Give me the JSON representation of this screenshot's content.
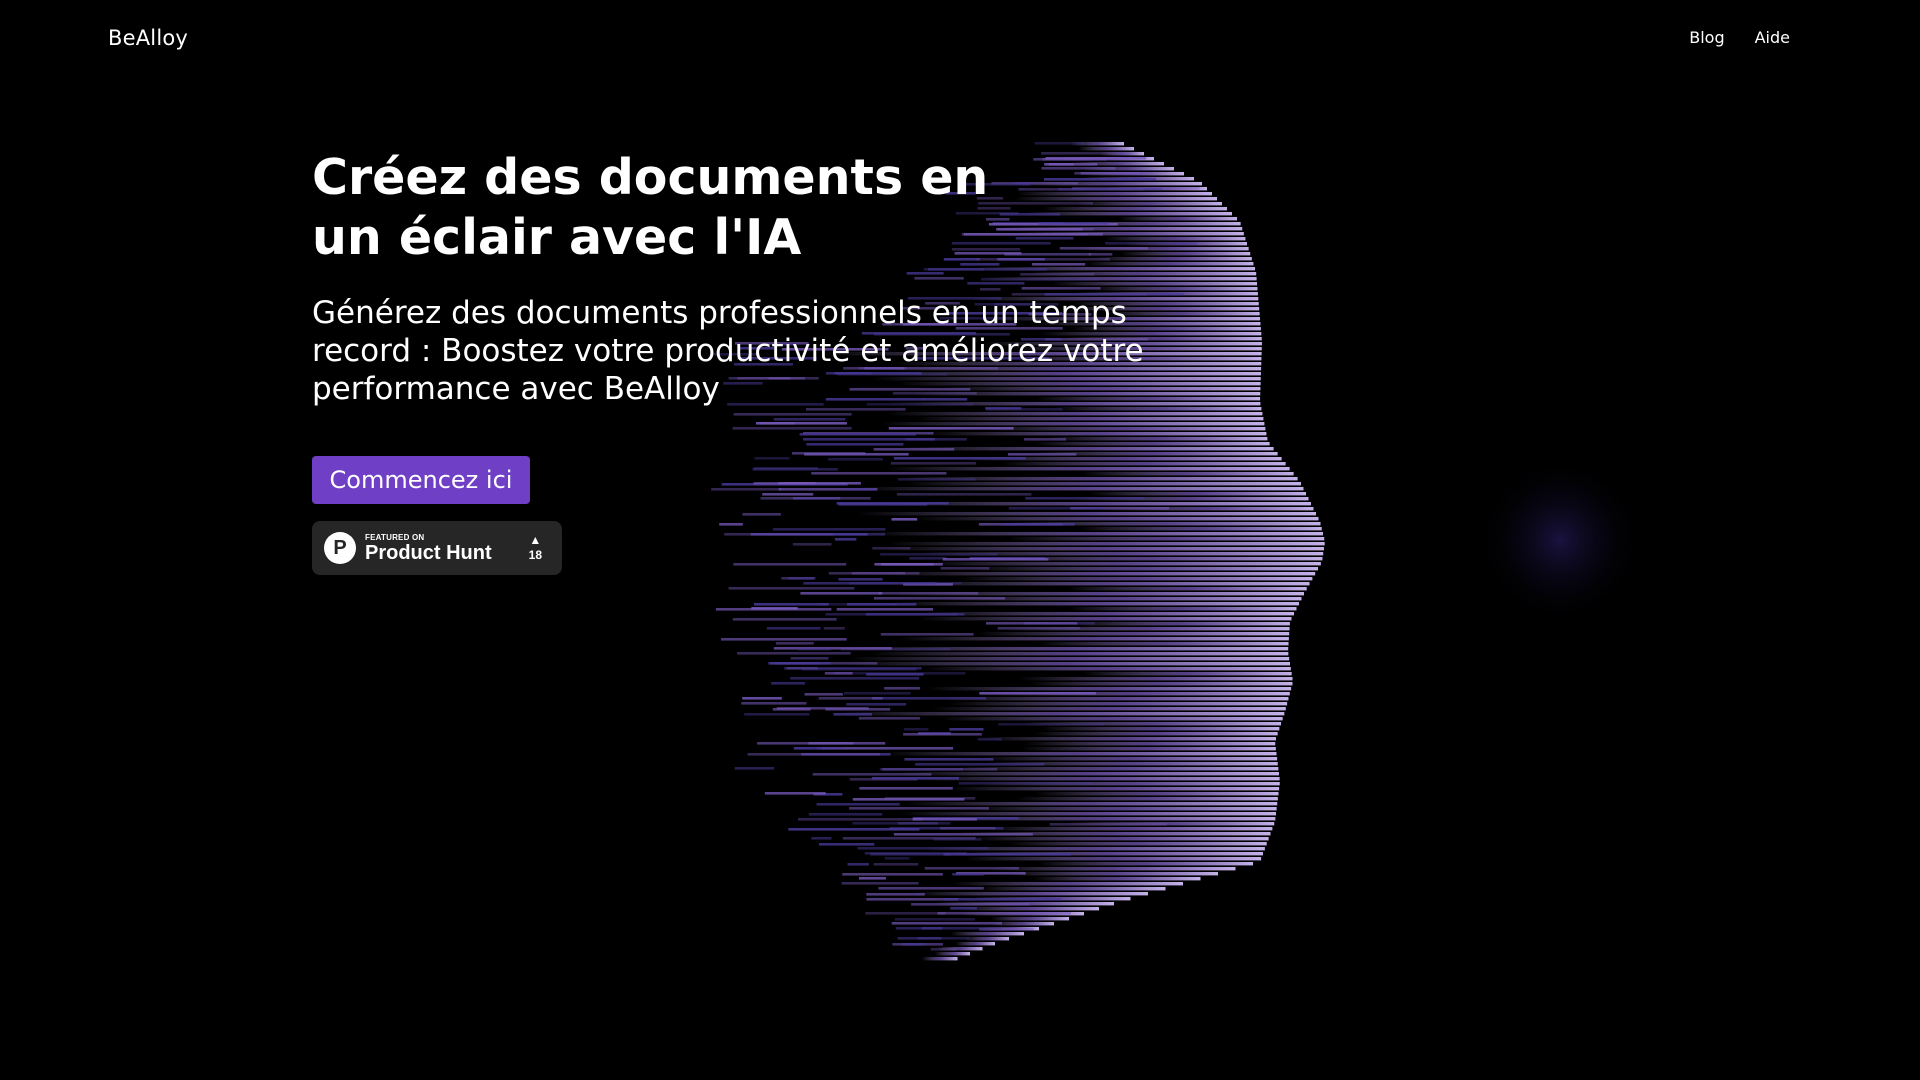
{
  "header": {
    "brand": "BeAlloy",
    "nav": [
      {
        "label": "Blog"
      },
      {
        "label": "Aide"
      }
    ]
  },
  "hero": {
    "title": "Créez des documents en un éclair avec l'IA",
    "subtitle": "Générez des documents professionnels en un temps record : Boostez votre productivité et améliorez votre performance avec BeAlloy",
    "cta_label": "Commencez ici"
  },
  "product_hunt": {
    "featured_label": "FEATURED ON",
    "name": "Product Hunt",
    "logo_letter": "P",
    "upvote_icon": "▲",
    "votes": "18"
  },
  "colors": {
    "background": "#000000",
    "accent": "#6f3fc6",
    "face_light": "#b7a2e0",
    "face_mid": "#7a5bbf",
    "face_dark": "#2a1f6a"
  },
  "illustration": {
    "icon": "ai-face-silhouette"
  }
}
